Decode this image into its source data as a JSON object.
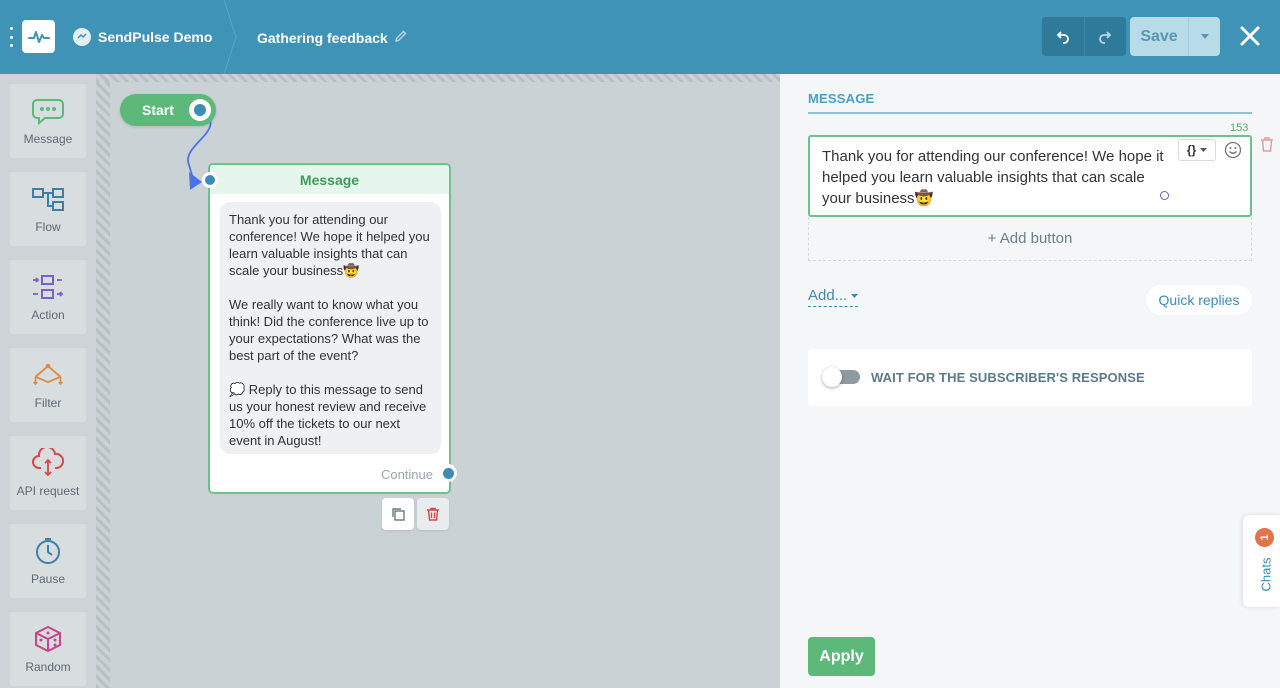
{
  "header": {
    "bot_name": "SendPulse Demo",
    "flow_name": "Gathering feedback",
    "save_label": "Save",
    "brand_color": "#3f93b7"
  },
  "toolbar": {
    "items": [
      {
        "label": "Message",
        "icon": "message-icon"
      },
      {
        "label": "Flow",
        "icon": "flow-icon"
      },
      {
        "label": "Action",
        "icon": "action-icon"
      },
      {
        "label": "Filter",
        "icon": "filter-icon"
      },
      {
        "label": "API request",
        "icon": "api-request-icon"
      },
      {
        "label": "Pause",
        "icon": "pause-icon"
      },
      {
        "label": "Random",
        "icon": "random-icon"
      }
    ]
  },
  "canvas": {
    "start_label": "Start",
    "message_node": {
      "title": "Message",
      "paragraphs": [
        "Thank you for attending our conference! We hope it helped you learn valuable insights that can scale your business🤠",
        "We really want to know what you think! Did the conference live up to your expectations? What was the best part of the event?",
        "💭 Reply to this message to send us your honest review and receive 10% off the tickets to our next event in August!"
      ],
      "continue_label": "Continue"
    }
  },
  "panel": {
    "title": "MESSAGE",
    "char_count": "153",
    "message_text": "Thank you for attending our conference! We hope it helped you learn valuable insights that can scale your business🤠",
    "var_button": "{}",
    "add_button_label": "+ Add button",
    "add_link": "Add...",
    "quick_replies": "Quick replies",
    "wait_label": "WAIT FOR THE SUBSCRIBER'S RESPONSE",
    "wait_enabled": false,
    "apply_label": "Apply"
  },
  "chats": {
    "label": "Chats",
    "badge": "1"
  }
}
